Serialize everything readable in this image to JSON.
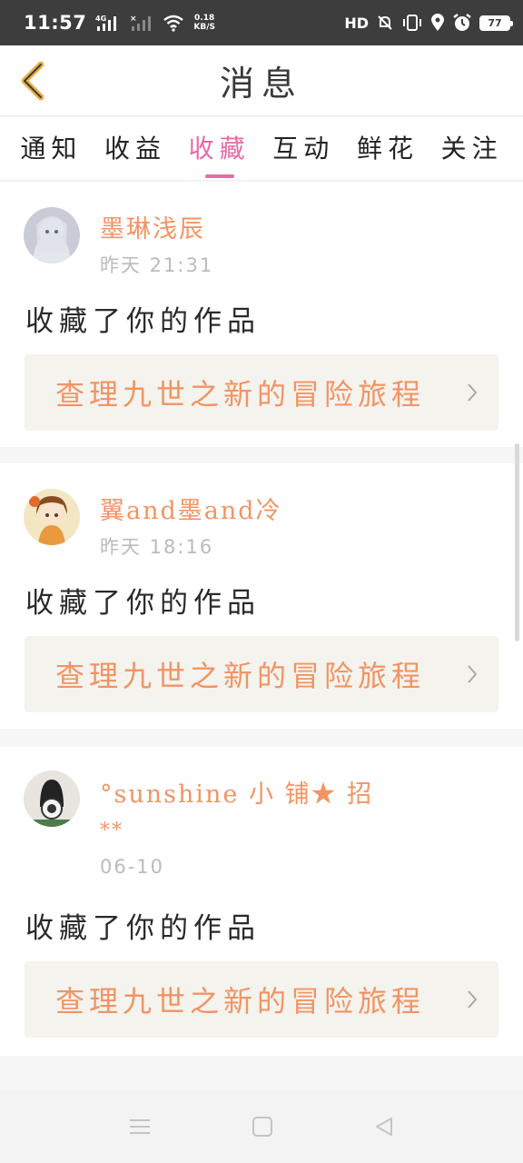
{
  "status_bar": {
    "time": "11:57",
    "network": "4G",
    "net_speed_value": "0.18",
    "net_speed_unit": "KB/S",
    "hd_label": "HD",
    "battery": "77"
  },
  "header": {
    "title": "消息"
  },
  "tabs": [
    {
      "label": "通知",
      "active": false
    },
    {
      "label": "收益",
      "active": false
    },
    {
      "label": "收藏",
      "active": true
    },
    {
      "label": "互动",
      "active": false
    },
    {
      "label": "鲜花",
      "active": false
    },
    {
      "label": "关注",
      "active": false
    }
  ],
  "messages": [
    {
      "username": "墨琳浅辰",
      "time": "昨天 21:31",
      "action": "收藏了你的作品",
      "work_title": "查理九世之新的冒险旅程"
    },
    {
      "username": "翼and墨and冷",
      "time": "昨天 18:16",
      "action": "收藏了你的作品",
      "work_title": "查理九世之新的冒险旅程"
    },
    {
      "username": "°sunshine 小 铺★ 招",
      "username_line2": "**",
      "time": "06-10",
      "action": "收藏了你的作品",
      "work_title": "查理九世之新的冒险旅程"
    }
  ],
  "colors": {
    "accent_pink": "#e86aa6",
    "username_orange": "#f29464",
    "work_box_bg": "#f4f3ee",
    "status_bar_bg": "#3d3d3d"
  }
}
